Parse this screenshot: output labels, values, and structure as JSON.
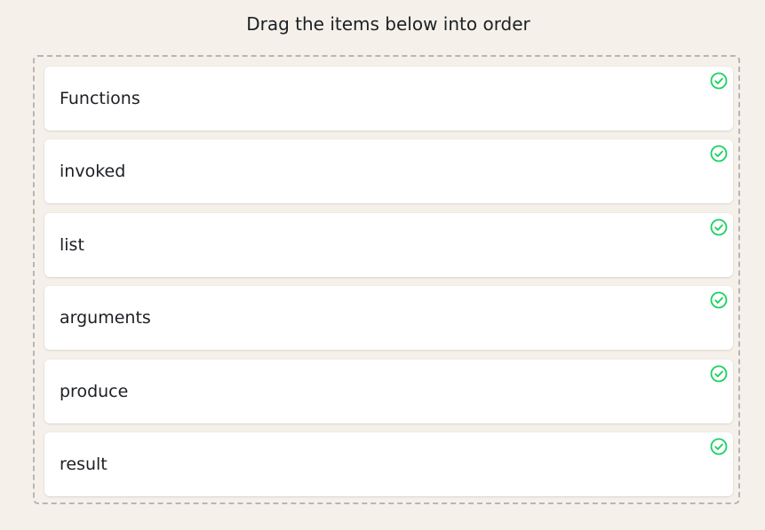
{
  "instruction": "Drag the items below into order",
  "items": [
    {
      "label": "Functions",
      "status": "correct"
    },
    {
      "label": "invoked",
      "status": "correct"
    },
    {
      "label": "list",
      "status": "correct"
    },
    {
      "label": "arguments",
      "status": "correct"
    },
    {
      "label": "produce",
      "status": "correct"
    },
    {
      "label": "result",
      "status": "correct"
    }
  ],
  "colors": {
    "background": "#f5f1ea",
    "card": "#ffffff",
    "check": "#19d15f",
    "border": "#b8b6b2"
  },
  "icons": {
    "status": "check-circle-icon"
  }
}
